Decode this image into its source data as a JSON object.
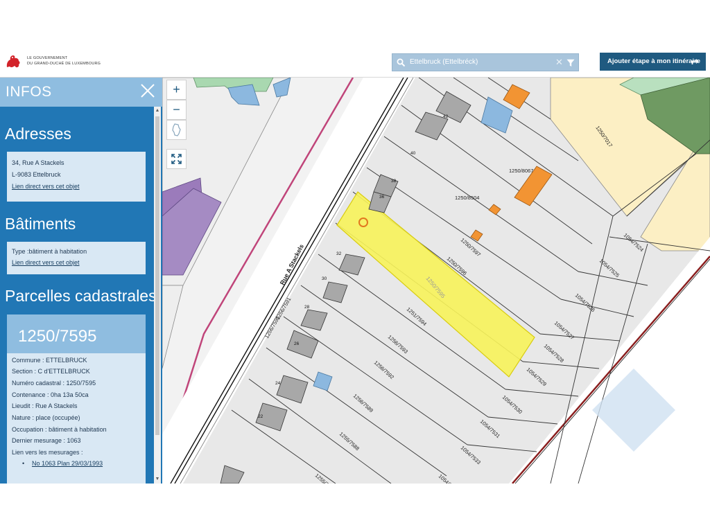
{
  "header": {
    "logo_line1": "LE GOUVERNEMENT",
    "logo_line2": "DU GRAND-DUCHÉ DE LUXEMBOURG",
    "search_value": "Ettelbruck (Ettelbréck)",
    "itinerary_button": "Ajouter étape à mon itinéraire",
    "icons": {
      "search": "search-icon",
      "clear": "close-icon",
      "filter": "filter-icon",
      "arrow": "turn-right-arrow-icon"
    }
  },
  "sidebar": {
    "title": "INFOS",
    "addresses": {
      "heading": "Adresses",
      "street": "34, Rue A Stackels",
      "city": "L-9083 Ettelbruck",
      "link": "Lien direct vers cet objet"
    },
    "buildings": {
      "heading": "Bâtiments",
      "type": "Type :bâtiment à habitation",
      "link": "Lien direct vers cet objet"
    },
    "parcels": {
      "heading": "Parcelles cadastrales",
      "parcel_id": "1250/7595",
      "lines": [
        "Commune : ETTELBRUCK",
        "Section : C d'ETTELBRUCK",
        "Numéro cadastral : 1250/7595",
        "Contenance : 0ha 13a 50ca",
        "Lieudit : Rue A Stackels",
        "Nature : place (occupée)",
        "Occupation : bâtiment à habitation",
        "Dernier mesurage : 1063",
        "Lien vers les mesurages :"
      ],
      "measure_link": "No 1063 Plan 29/03/1993"
    }
  },
  "map": {
    "controls": {
      "zoom_in": "+",
      "zoom_out": "−"
    },
    "street_label": "Rue A Stackels",
    "highlighted_parcel": "1250/7595",
    "highlight_color": "#f7f35a",
    "house_numbers": [
      "42",
      "40",
      "38",
      "36",
      "32",
      "30",
      "28",
      "26",
      "24",
      "22"
    ],
    "parcel_labels": [
      "1250/7017",
      "1250/8067",
      "1250/8504",
      "1250/7597",
      "1250/7596",
      "1250/7595",
      "1251/7594",
      "1256/7593",
      "1256/7592",
      "1256/7589",
      "1255/7588",
      "1255/7587",
      "1256/7590",
      "1256/7591",
      "1054/7524",
      "1054/7525",
      "1054/7526",
      "1054/7527",
      "1054/7528",
      "1054/7529",
      "1054/7530",
      "1054/7531",
      "1054/7533",
      "1054/75"
    ]
  },
  "colors": {
    "sidebar_blue": "#2177b5",
    "sidebar_light": "#8fbde0",
    "card_bg": "#d9e8f4",
    "header_button": "#1f5a80",
    "building_gray": "#a8a8a8",
    "orange": "#f29433"
  }
}
